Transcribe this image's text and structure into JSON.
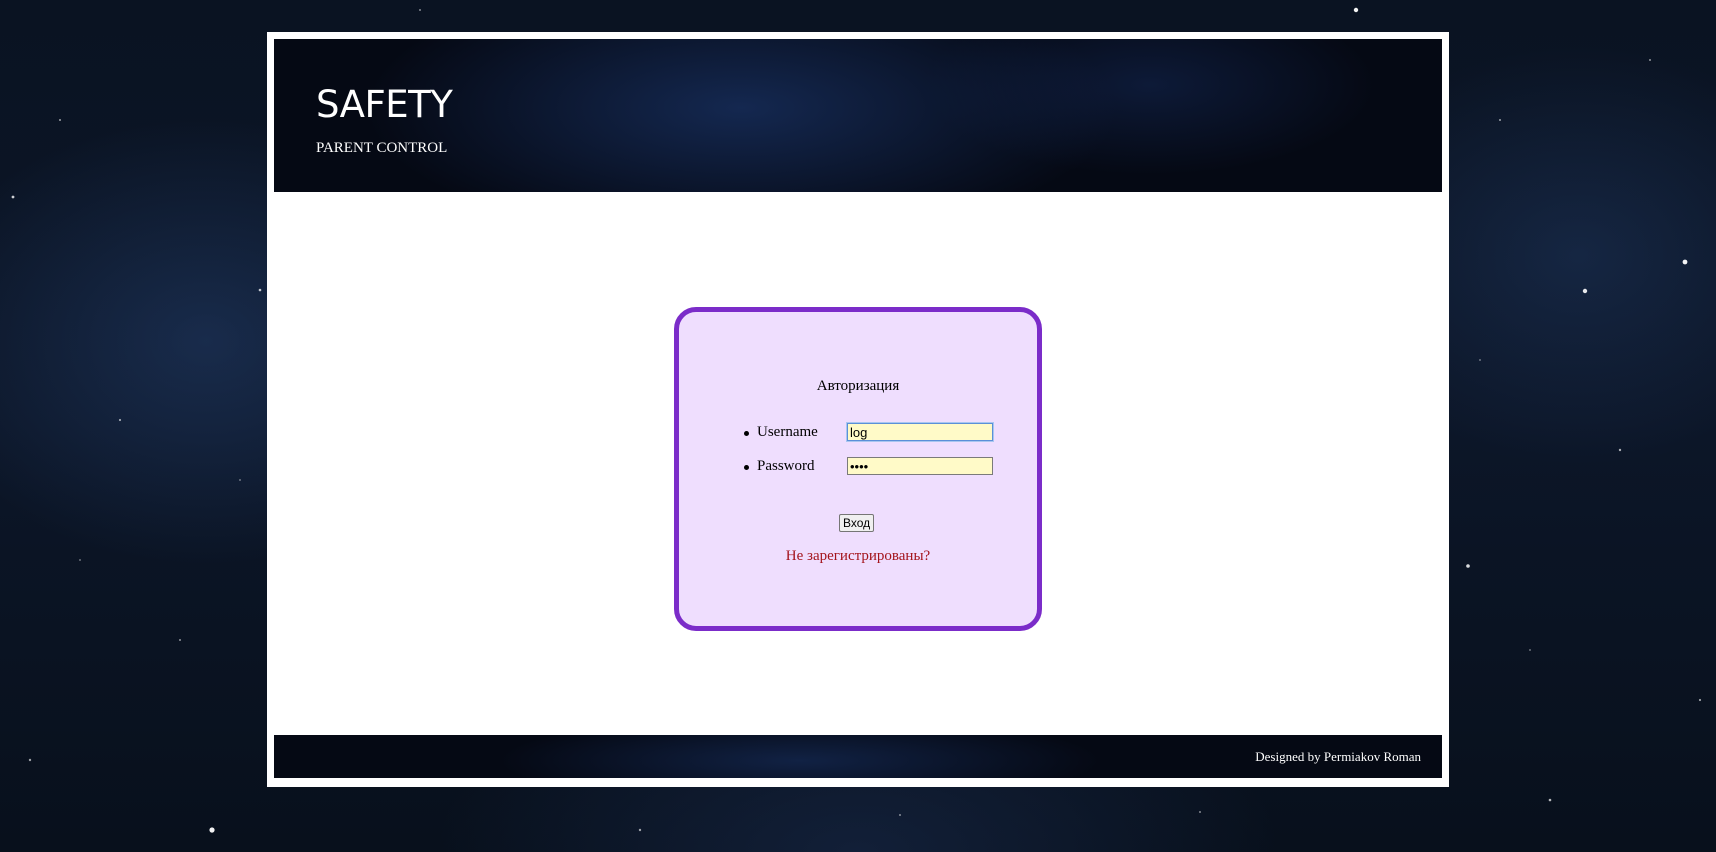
{
  "header": {
    "title": "SAFETY",
    "subtitle": "PARENT CONTROL"
  },
  "login": {
    "title": "Авторизация",
    "username_label": "Username",
    "username_value": "log",
    "password_label": "Password",
    "password_value": "••••",
    "submit_label": "Вход",
    "register_link": "Не зарегистрированы?"
  },
  "footer": {
    "credit": "Designed by Permiakov Roman"
  },
  "colors": {
    "login_border": "#7b2cc9",
    "login_background": "#efdefe",
    "input_background": "#fffac8",
    "register_link": "#a4141c"
  }
}
